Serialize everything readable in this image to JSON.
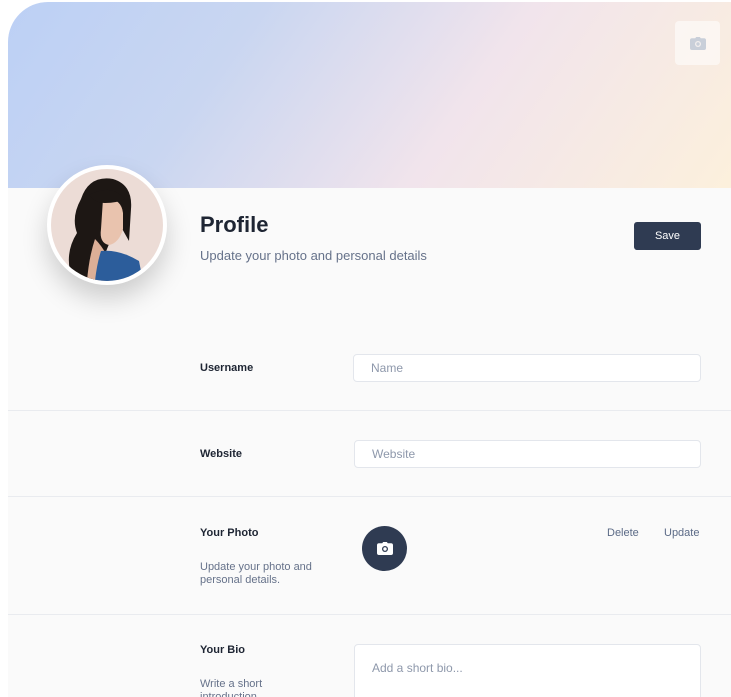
{
  "header": {
    "title": "Profile",
    "subtitle": "Update your photo and personal details",
    "save_label": "Save"
  },
  "cover": {
    "camera_icon": "camera-icon"
  },
  "avatar": {
    "description_icon": "user-photo"
  },
  "form": {
    "username": {
      "label": "Username",
      "placeholder": "Name"
    },
    "website": {
      "label": "Website",
      "placeholder": "Website"
    },
    "photo": {
      "label": "Your Photo",
      "help": "Update your photo and personal details.",
      "delete_label": "Delete",
      "update_label": "Update",
      "icon": "camera-icon"
    },
    "bio": {
      "label": "Your Bio",
      "help": "Write a short introduction",
      "placeholder": "Add a short bio..."
    }
  },
  "colors": {
    "primary": "#2f3b52",
    "muted_text": "#66728a",
    "heading": "#1e2533",
    "border": "#e3e6ec"
  }
}
